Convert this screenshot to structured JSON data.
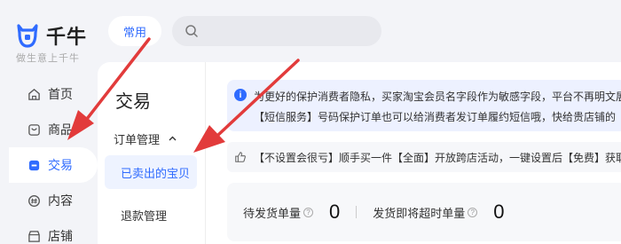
{
  "brand": {
    "name": "千牛",
    "slogan": "做生意上千牛"
  },
  "nav": {
    "items": [
      {
        "label": "首页",
        "icon": "home-icon"
      },
      {
        "label": "商品",
        "icon": "goods-icon"
      },
      {
        "label": "交易",
        "icon": "trade-icon",
        "active": true
      },
      {
        "label": "内容",
        "icon": "content-icon"
      },
      {
        "label": "店铺",
        "icon": "shop-icon"
      }
    ]
  },
  "topbar": {
    "common_label": "常用",
    "search_placeholder": ""
  },
  "subnav": {
    "title": "交易",
    "group_label": "订单管理",
    "items": [
      {
        "label": "已卖出的宝贝",
        "active": true
      },
      {
        "label": "退款管理"
      }
    ]
  },
  "notice": {
    "line1": "为更好的保护消费者隐私，买家淘宝会员名字段作为敏感字段，平台不再明文展",
    "line2": "【短信服务】号码保护订单也可以给消费者发订单履约短信哦，快给贵店铺的"
  },
  "promo": {
    "text": "【不设置会很亏】顺手买一件【全面】开放跨店活动，一键设置后【免费】获取"
  },
  "stats": {
    "pending_label": "待发货单量",
    "pending_value": "0",
    "overdue_label": "发货即将超时单量",
    "overdue_value": "0"
  },
  "colors": {
    "accent": "#2f6bff",
    "arrow": "#e23b3b"
  }
}
